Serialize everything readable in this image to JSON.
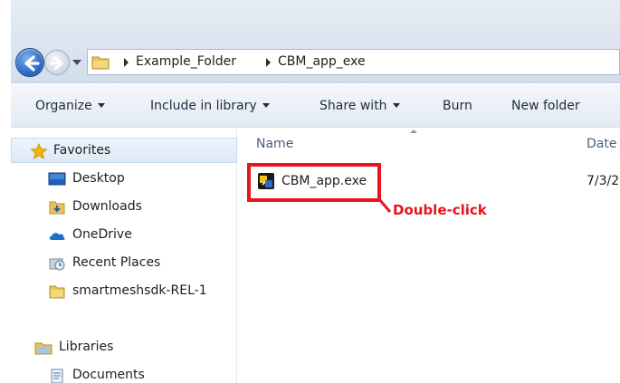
{
  "address_bar": {
    "breadcrumbs": [
      "Example_Folder",
      "CBM_app_exe"
    ]
  },
  "toolbar": {
    "items": [
      {
        "label": "Organize",
        "dropdown": true
      },
      {
        "label": "Include in library",
        "dropdown": true
      },
      {
        "label": "Share with",
        "dropdown": true
      },
      {
        "label": "Burn",
        "dropdown": false
      },
      {
        "label": "New folder",
        "dropdown": false
      }
    ]
  },
  "nav_pane": {
    "favorites_label": "Favorites",
    "favorites": [
      {
        "label": "Desktop",
        "icon": "desktop-icon"
      },
      {
        "label": "Downloads",
        "icon": "downloads-icon"
      },
      {
        "label": "OneDrive",
        "icon": "onedrive-icon"
      },
      {
        "label": "Recent Places",
        "icon": "recent-places-icon"
      },
      {
        "label": "smartmeshsdk-REL-1",
        "icon": "folder-icon"
      }
    ],
    "libraries_label": "Libraries",
    "libraries": [
      {
        "label": "Documents",
        "icon": "documents-icon"
      }
    ]
  },
  "file_list": {
    "columns": {
      "name": "Name",
      "date": "Date"
    },
    "files": [
      {
        "name": "CBM_app.exe",
        "date": "7/3/2",
        "icon": "exe-app-icon"
      }
    ]
  },
  "annotation": {
    "callout_text": "Double-click",
    "color": "#e8141c"
  }
}
